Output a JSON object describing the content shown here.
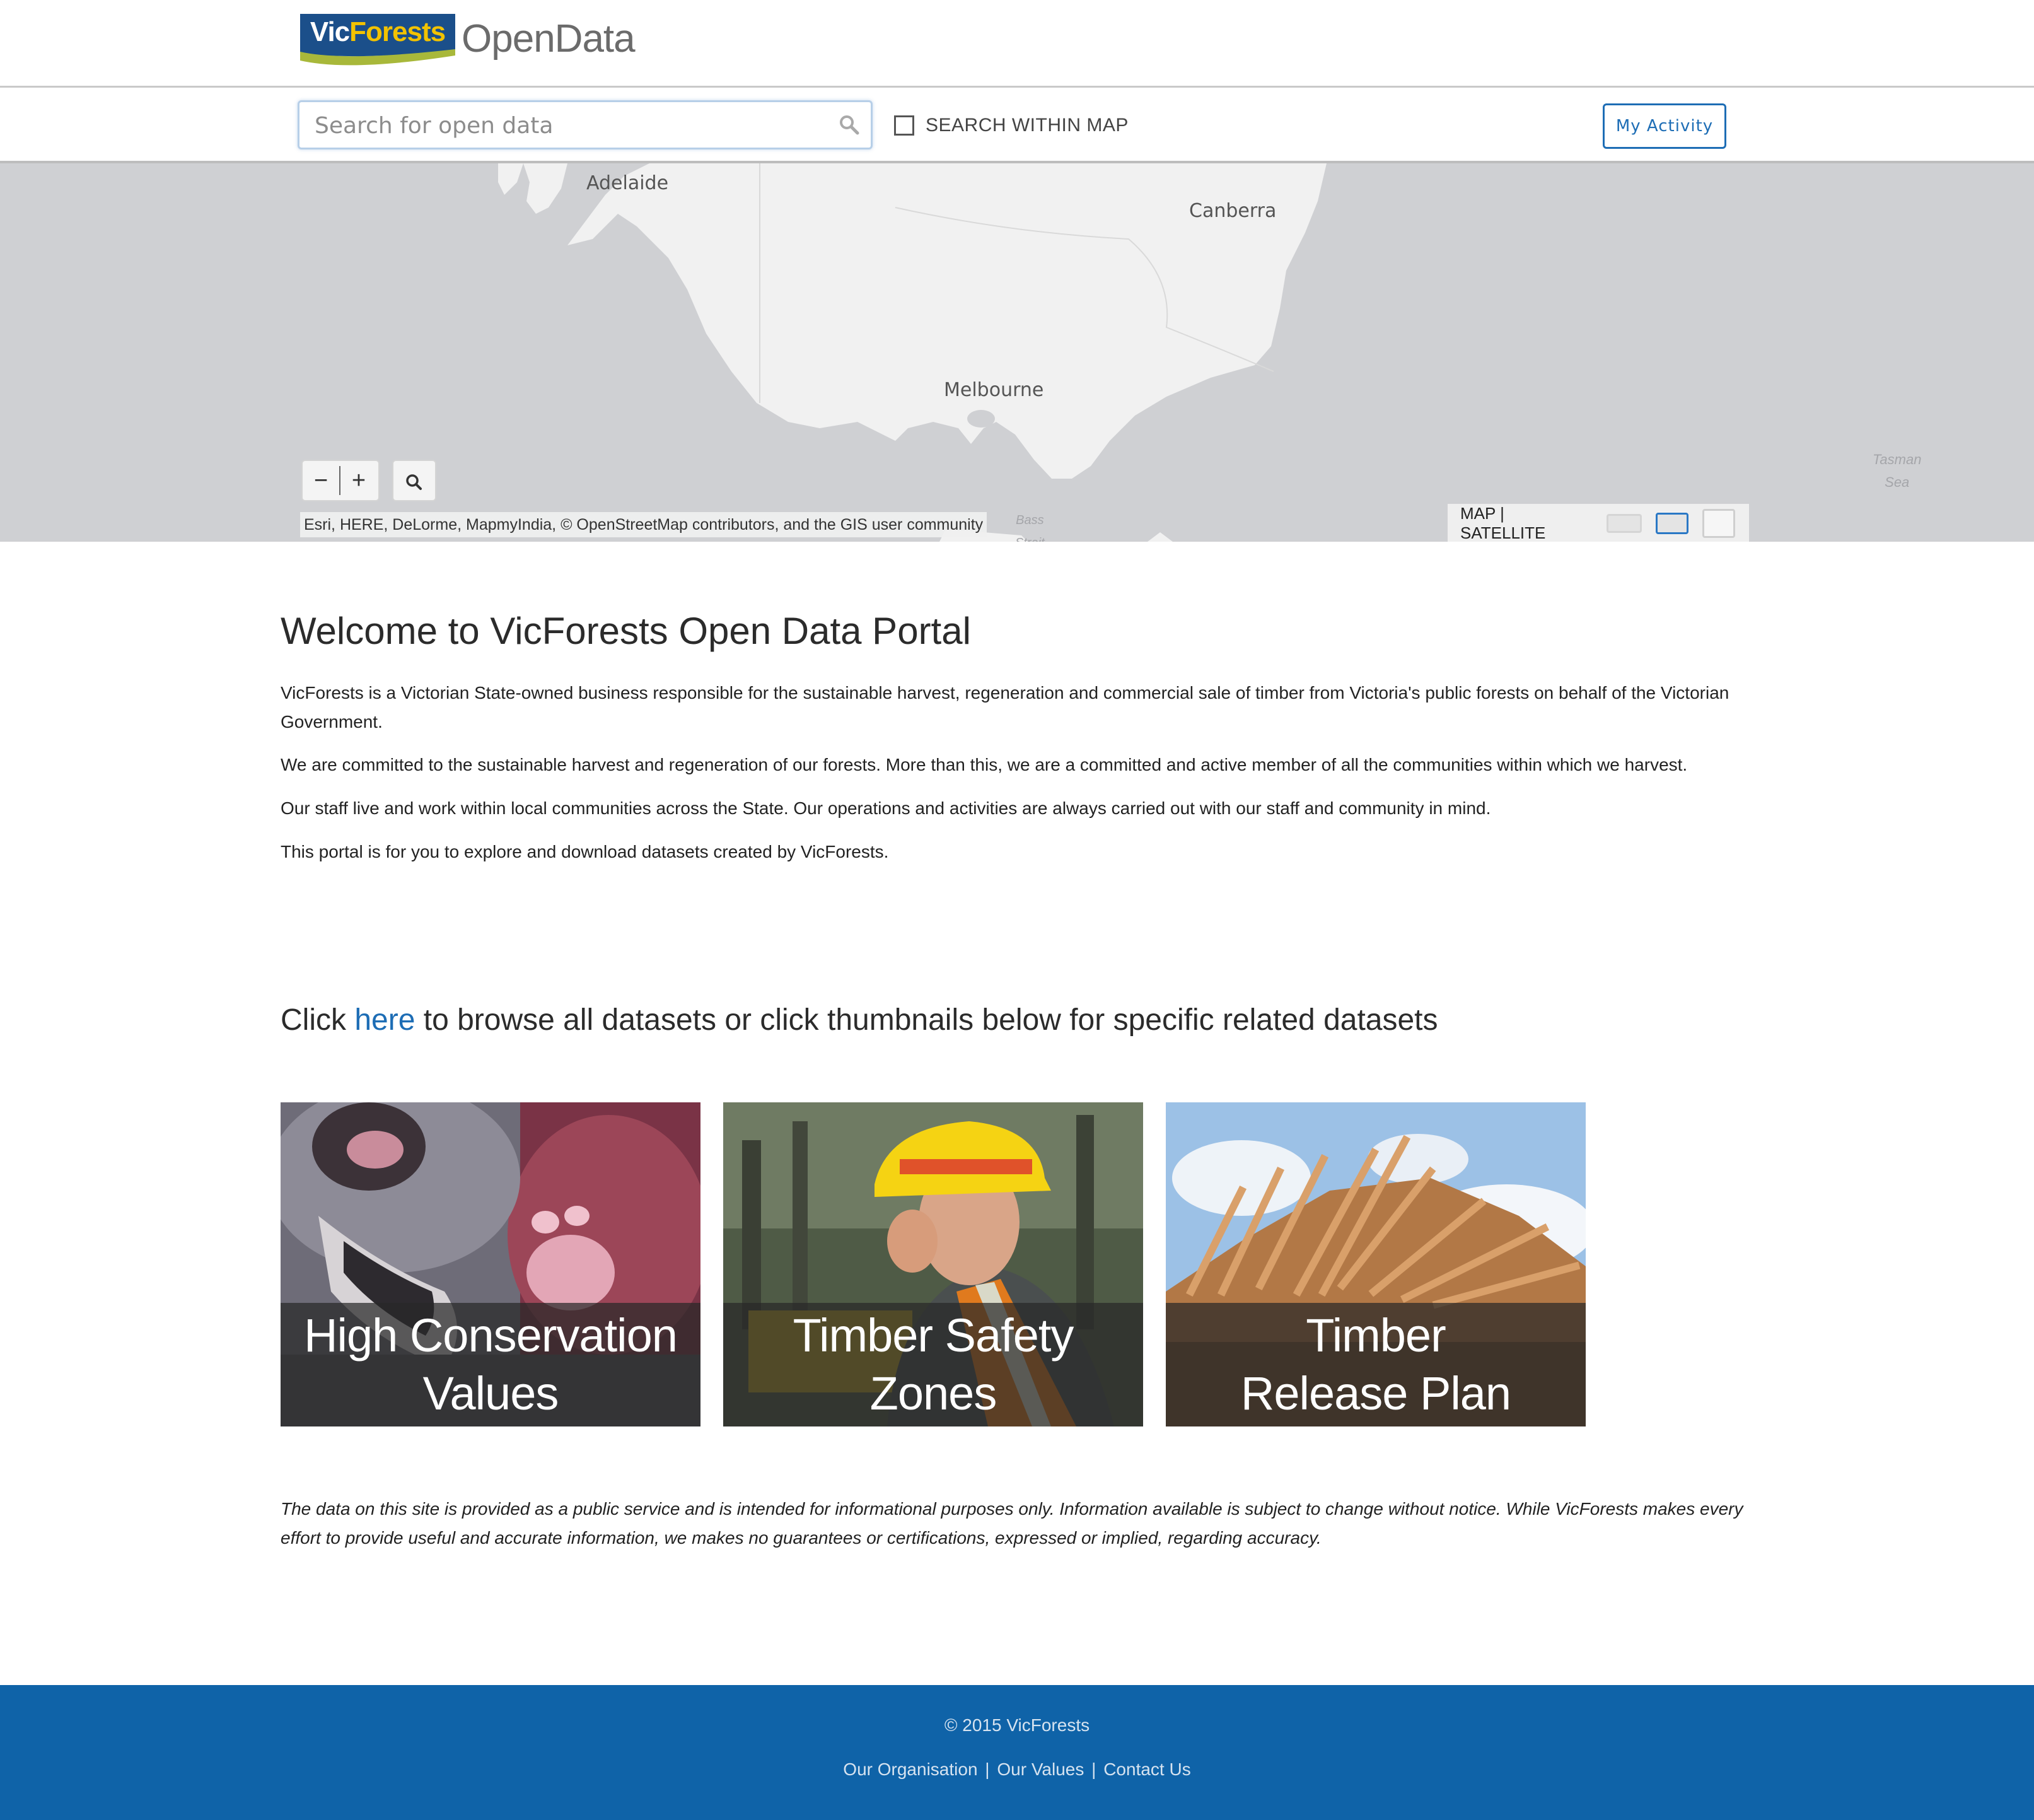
{
  "header": {
    "logo_text_a": "Vic",
    "logo_text_b": "Forests",
    "app_title": "OpenData"
  },
  "search": {
    "placeholder": "Search for open data",
    "value": "",
    "within_map_label": "SEARCH WITHIN MAP",
    "within_map_checked": false,
    "activity_button": "My Activity"
  },
  "map": {
    "cities": [
      "Adelaide",
      "Canberra",
      "Melbourne"
    ],
    "sea_label_1": "Tasman",
    "sea_label_2": "Sea",
    "strait_label_1": "Bass",
    "strait_label_2": "Strait",
    "zoom_out": "−",
    "zoom_in": "+",
    "attribution": "Esri, HERE, DeLorme, MapmyIndia, © OpenStreetMap contributors, and the GIS user community",
    "basemap_map": "MAP",
    "basemap_separator": "|",
    "basemap_satellite": "SATELLITE",
    "water_color": "#cfd0d3",
    "land_color": "#f1f1f1"
  },
  "content": {
    "welcome_title": "Welcome to VicForests Open Data Portal",
    "paragraphs": [
      "VicForests is a Victorian State-owned business responsible for the sustainable harvest, regeneration and commercial sale of timber from Victoria's public forests on behalf of the Victorian Government.",
      "We are committed to the sustainable harvest and regeneration of our forests. More than this, we are a committed and active member of all the communities within which we harvest.",
      "Our staff live and work within local communities across the State. Our operations and activities are always carried out with our staff and community in mind.",
      "This portal is for you to explore and download datasets created by VicForests."
    ],
    "browse_prefix": "Click ",
    "browse_link": "here",
    "browse_suffix": " to browse all datasets or click thumbnails below for specific related datasets",
    "tiles": [
      {
        "caption": "High Conservation\nValues"
      },
      {
        "caption": "Timber Safety\nZones"
      },
      {
        "caption": "Timber\nRelease Plan"
      }
    ],
    "disclaimer": "The data on this site is provided as a public service and is intended for informational purposes only. Information available is subject to change without notice. While VicForests makes every effort to provide useful and accurate information, we makes no guarantees or certifications, expressed or implied, regarding accuracy."
  },
  "footer": {
    "copyright": "© 2015 VicForests",
    "links": [
      "Our Organisation",
      "Our Values",
      "Contact Us"
    ],
    "separator": "|",
    "background": "#0f63a8"
  },
  "colors": {
    "accent": "#1d6db5"
  }
}
